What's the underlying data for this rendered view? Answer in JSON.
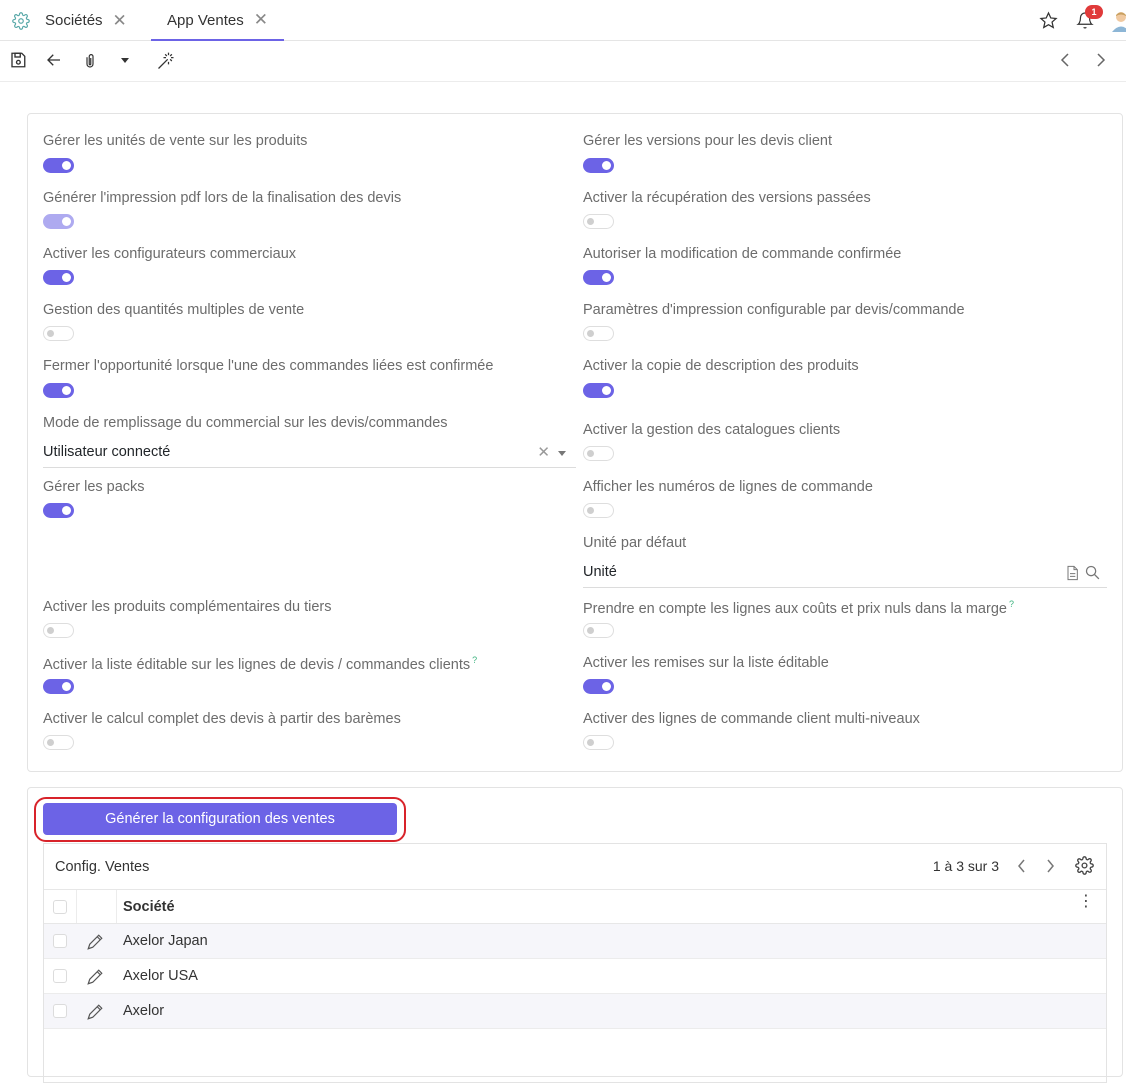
{
  "tabs": [
    {
      "label": "Sociétés",
      "active": false
    },
    {
      "label": "App Ventes",
      "active": true
    }
  ],
  "notifications": {
    "count": "1"
  },
  "colors": {
    "accent": "#6c63e6",
    "highlight_outline": "#d8232a",
    "toggle_off": "#cfcfcf"
  },
  "left_fields": [
    {
      "label": "Gérer les unités de vente sur les produits",
      "type": "toggle",
      "state": "on"
    },
    {
      "label": "Générer l'impression pdf lors de la finalisation des devis",
      "type": "toggle",
      "state": "dim"
    },
    {
      "label": "Activer les configurateurs commerciaux",
      "type": "toggle",
      "state": "on"
    },
    {
      "label": "Gestion des quantités multiples de vente",
      "type": "toggle",
      "state": "off"
    },
    {
      "label": "Fermer l'opportunité lorsque l'une des commandes liées est confirmée",
      "type": "toggle",
      "state": "on"
    },
    {
      "label": "Mode de remplissage du commercial sur les devis/commandes",
      "type": "select",
      "value": "Utilisateur connecté"
    },
    {
      "label": "Gérer les packs",
      "type": "toggle",
      "state": "on"
    },
    {
      "label": "Activer les produits complémentaires du tiers",
      "type": "toggle",
      "state": "off"
    },
    {
      "label": "Activer la liste éditable sur les lignes de devis / commandes clients",
      "type": "toggle",
      "state": "on",
      "help": "?"
    },
    {
      "label": "Activer le calcul complet des devis à partir des barèmes",
      "type": "toggle",
      "state": "off"
    }
  ],
  "right_fields": [
    {
      "label": "Gérer les versions pour les devis client",
      "type": "toggle",
      "state": "on"
    },
    {
      "label": "Activer la récupération des versions passées",
      "type": "toggle",
      "state": "off"
    },
    {
      "label": "Autoriser la modification de commande confirmée",
      "type": "toggle",
      "state": "on"
    },
    {
      "label": "Paramètres d'impression configurable par devis/commande",
      "type": "toggle",
      "state": "off"
    },
    {
      "label": "Activer la copie de description des produits",
      "type": "toggle",
      "state": "on"
    },
    {
      "label": "Activer la gestion des catalogues clients",
      "type": "toggle",
      "state": "off"
    },
    {
      "label": "Afficher les numéros de lignes de commande",
      "type": "toggle",
      "state": "off"
    },
    {
      "label": "Unité par défaut",
      "type": "relation",
      "value": "Unité"
    },
    {
      "label": "Prendre en compte les lignes aux coûts et prix nuls dans la marge",
      "type": "toggle",
      "state": "off",
      "help": "?"
    },
    {
      "label": "Activer les remises sur la liste éditable",
      "type": "toggle",
      "state": "on"
    },
    {
      "label": "Activer des lignes de commande client multi-niveaux",
      "type": "toggle",
      "state": "off"
    }
  ],
  "generate_button": "Générer la configuration des ventes",
  "grid": {
    "title": "Config. Ventes",
    "pager": "1 à 3 sur 3",
    "column": "Société",
    "rows": [
      "Axelor Japan",
      "Axelor USA",
      "Axelor"
    ]
  }
}
